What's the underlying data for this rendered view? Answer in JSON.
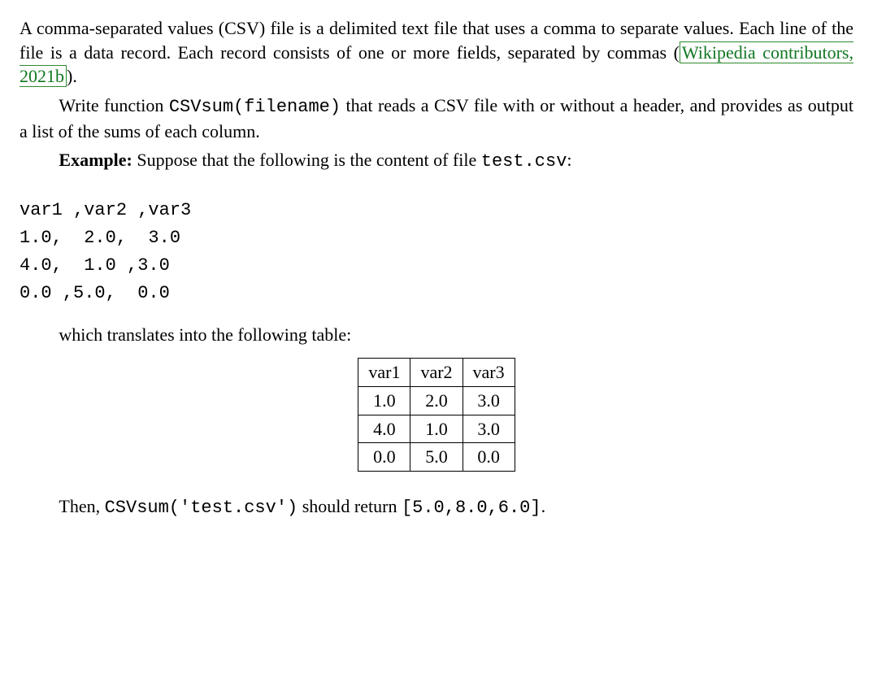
{
  "p1": {
    "lead": "A comma-separated values (CSV) file is a delimited text file that uses a comma to separate values. Each line of the file is a data record. Each record consists of one or more fields, separated by commas (",
    "cite": "Wikipedia contributors, 2021b",
    "tail": ")."
  },
  "p2": {
    "lead": "Write function ",
    "code": "CSVsum(filename)",
    "tail": " that reads a CSV file with or without a header, and provides as output a list of the sums of each column."
  },
  "p3": {
    "label": "Example:",
    "lead": " Suppose that the following is the content of file ",
    "code": "test.csv",
    "tail": ":"
  },
  "csv_block": "var1 ,var2 ,var3\n1.0,  2.0,  3.0\n4.0,  1.0 ,3.0\n0.0 ,5.0,  0.0",
  "p4": "which translates into the following table:",
  "chart_data": {
    "type": "table",
    "columns": [
      "var1",
      "var2",
      "var3"
    ],
    "rows": [
      [
        1.0,
        2.0,
        3.0
      ],
      [
        4.0,
        1.0,
        3.0
      ],
      [
        0.0,
        5.0,
        0.0
      ]
    ]
  },
  "table": {
    "h1": "var1",
    "h2": "var2",
    "h3": "var3",
    "r1c1": "1.0",
    "r1c2": "2.0",
    "r1c3": "3.0",
    "r2c1": "4.0",
    "r2c2": "1.0",
    "r2c3": "3.0",
    "r3c1": "0.0",
    "r3c2": "5.0",
    "r3c3": "0.0"
  },
  "p5": {
    "lead": "Then, ",
    "code1": "CSVsum('test.csv')",
    "mid": " should return ",
    "code2": "[5.0,8.0,6.0]",
    "tail": "."
  }
}
